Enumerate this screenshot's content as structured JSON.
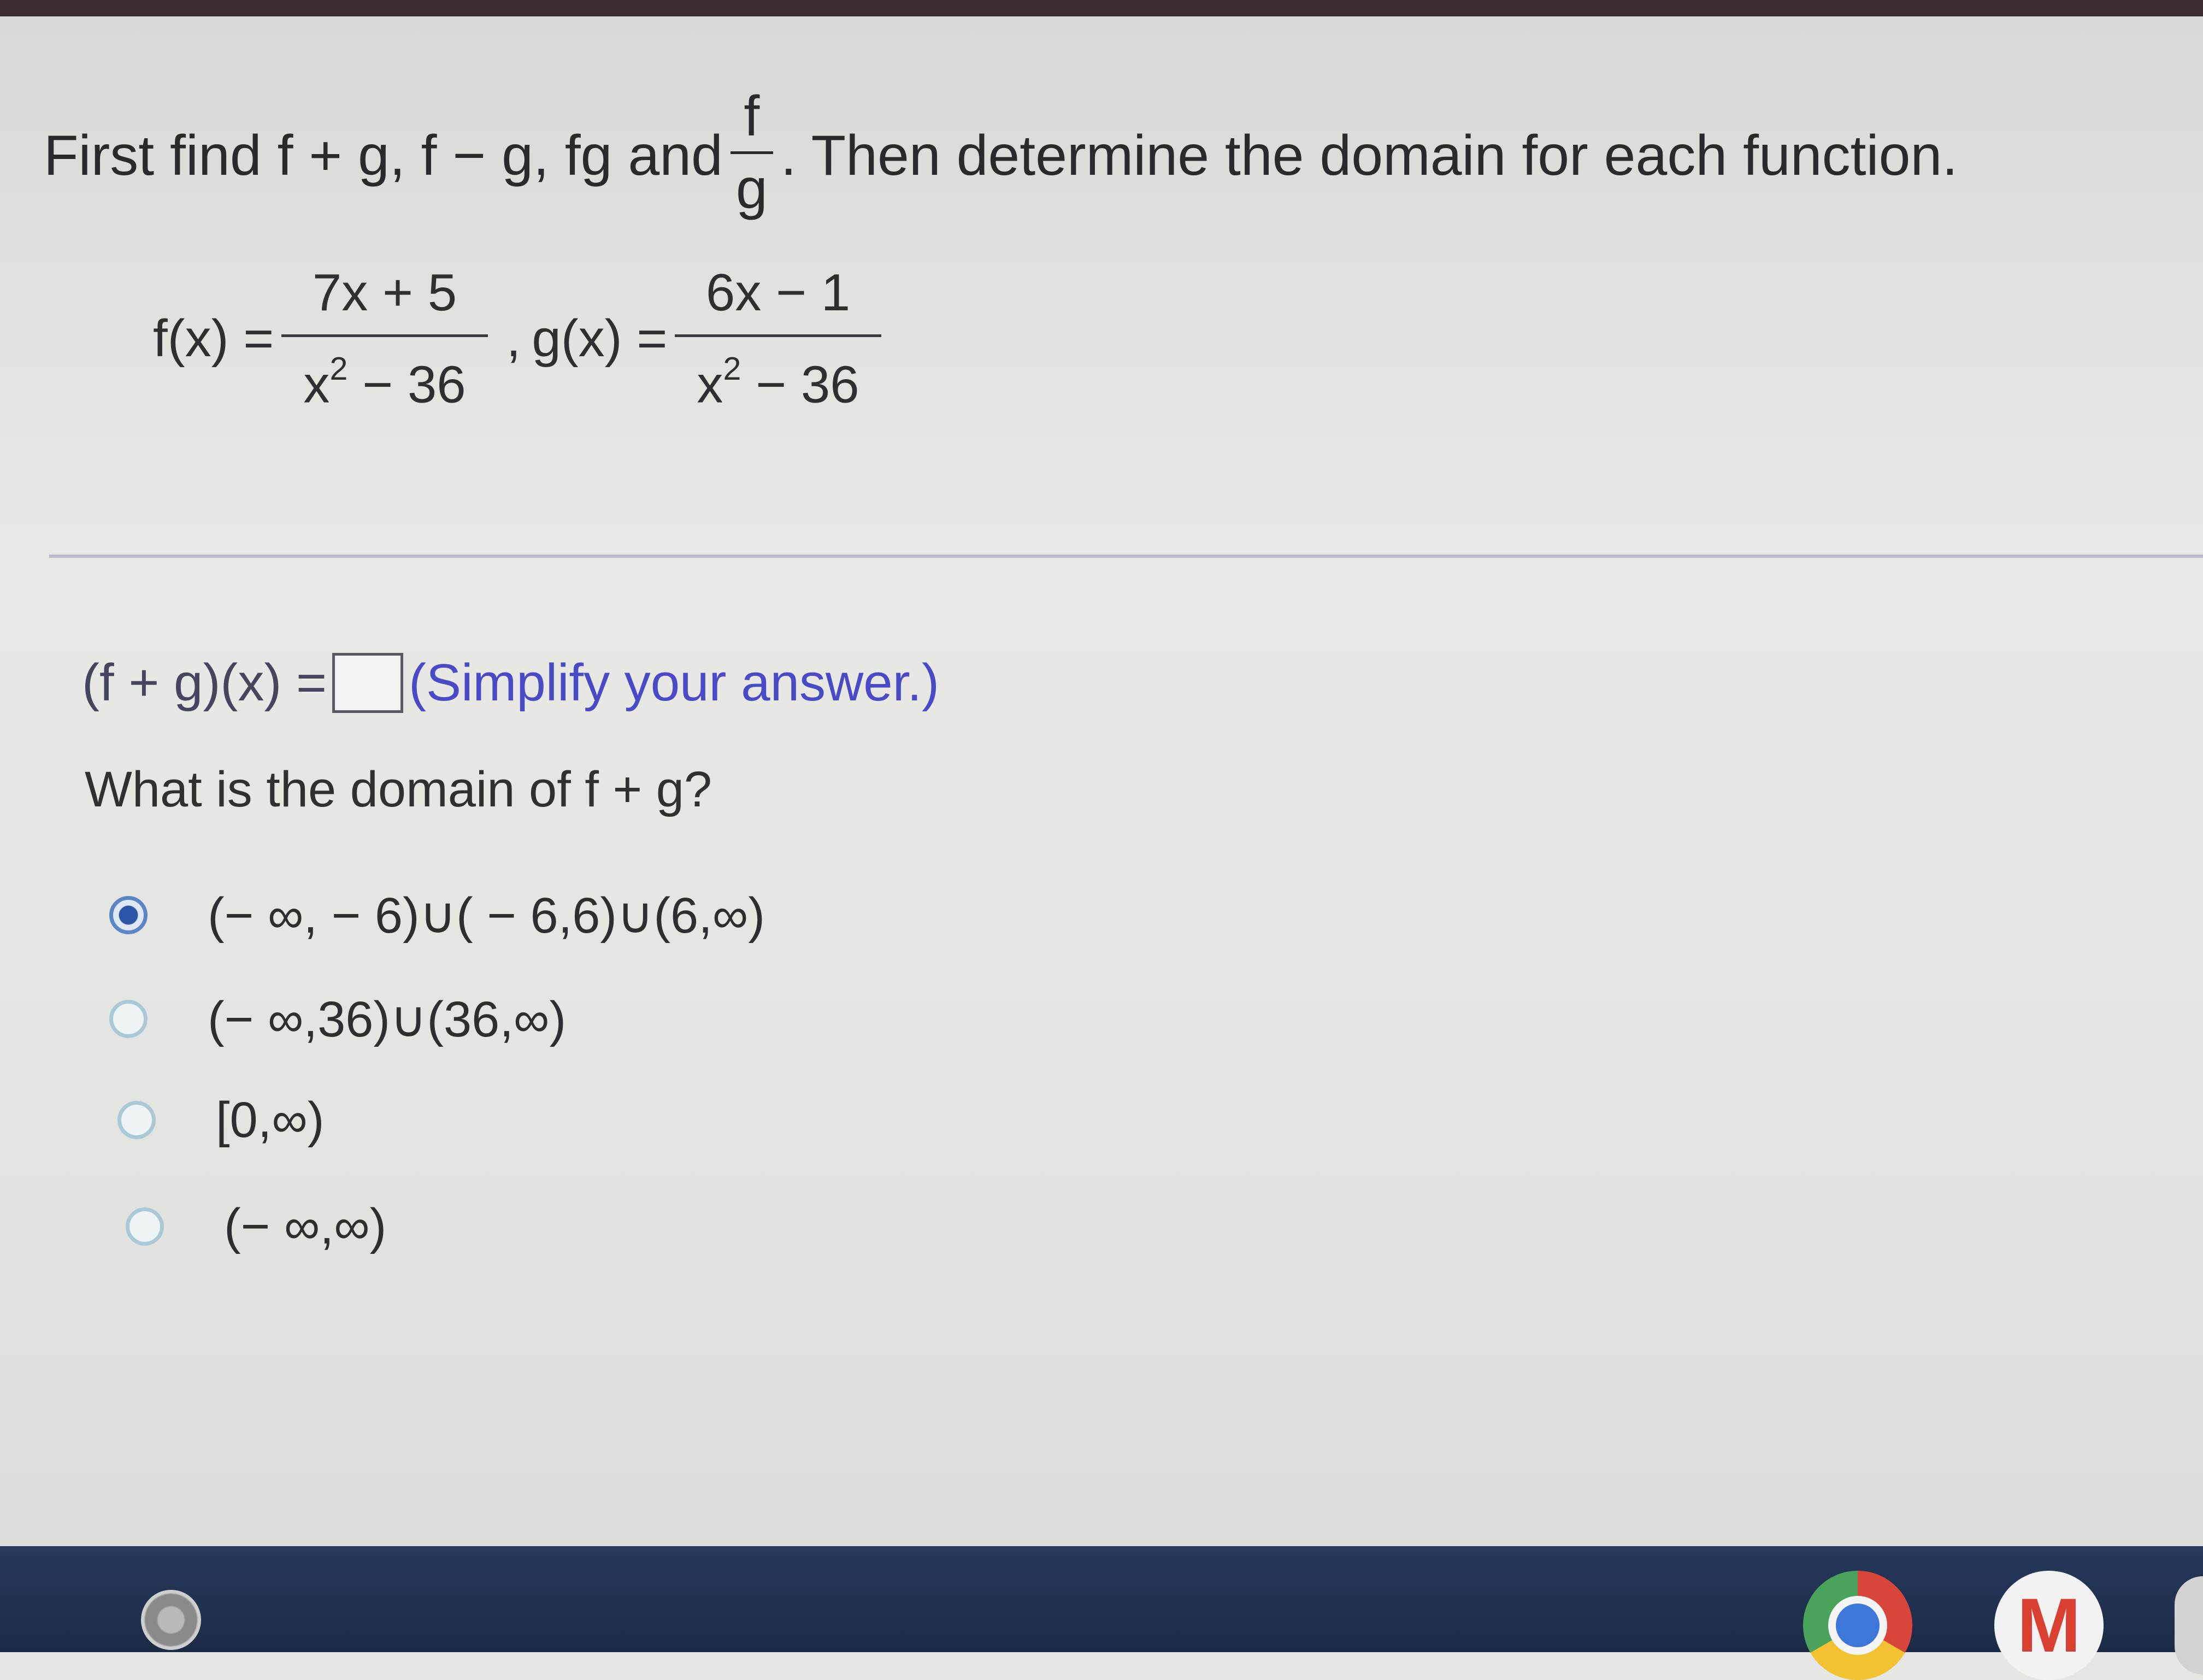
{
  "problem": {
    "intro": "First find f + g, f − g, fg and",
    "frac_num": "f",
    "frac_den": "g",
    "outro": ". Then determine the domain for each function."
  },
  "functions": {
    "f_label": "f(x) =",
    "f_num": "7x + 5",
    "f_den_base": "x",
    "f_den_exp": "2",
    "f_den_rest": " − 36",
    "separator": ",",
    "g_label": "g(x) =",
    "g_num": "6x − 1",
    "g_den_base": "x",
    "g_den_exp": "2",
    "g_den_rest": " − 36"
  },
  "answer": {
    "label": "(f + g)(x) =",
    "value": "",
    "hint": "(Simplify your answer.)"
  },
  "question": "What is the domain of f + g?",
  "choices": [
    {
      "label": "(− ∞, − 6)∪( − 6,6)∪(6,∞)",
      "selected": true
    },
    {
      "label": "(− ∞,36)∪(36,∞)",
      "selected": false
    },
    {
      "label": "[0,∞)",
      "selected": false
    },
    {
      "label": "(− ∞,∞)",
      "selected": false
    }
  ],
  "taskbar": {
    "gmail_glyph": "M"
  }
}
